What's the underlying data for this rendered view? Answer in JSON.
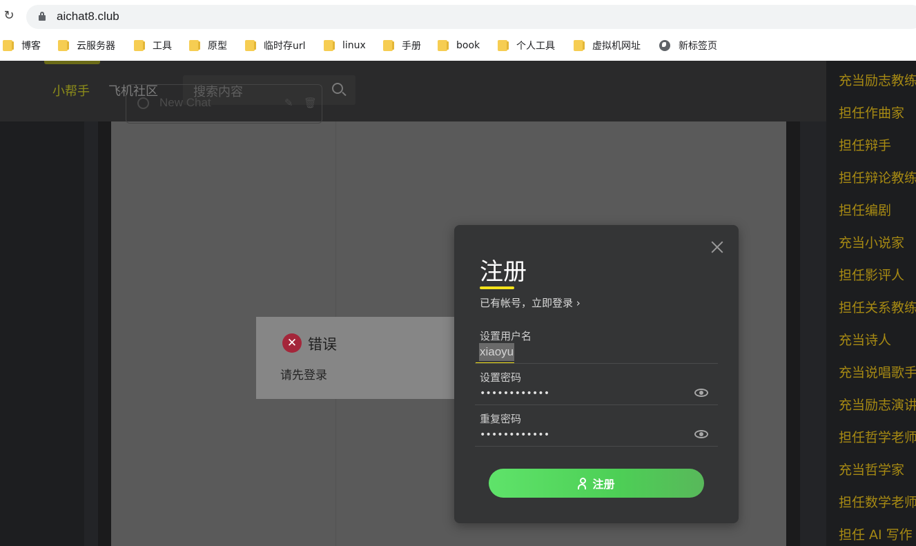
{
  "browser": {
    "url": "aichat8.club",
    "bookmarks": [
      {
        "label": "博客",
        "icon": "folder-icon"
      },
      {
        "label": "云服务器",
        "icon": "folder-icon"
      },
      {
        "label": "工具",
        "icon": "folder-icon"
      },
      {
        "label": "原型",
        "icon": "folder-icon"
      },
      {
        "label": "临时存url",
        "icon": "folder-icon"
      },
      {
        "label": "linux",
        "icon": "folder-icon"
      },
      {
        "label": "手册",
        "icon": "folder-icon"
      },
      {
        "label": "book",
        "icon": "folder-icon"
      },
      {
        "label": "个人工具",
        "icon": "folder-icon"
      },
      {
        "label": "虚拟机网址",
        "icon": "folder-icon"
      },
      {
        "label": "新标签页",
        "icon": "globe-icon"
      }
    ]
  },
  "header": {
    "nav": [
      "小帮手",
      "飞机社区"
    ],
    "search_placeholder": "搜索内容"
  },
  "sidebar": {
    "new_chat_label": "New Chat"
  },
  "roles": [
    "充当励志教练",
    "担任作曲家",
    "担任辩手",
    "担任辩论教练",
    "担任编剧",
    "充当小说家",
    "担任影评人",
    "担任关系教练",
    "充当诗人",
    "充当说唱歌手",
    "充当励志演讲",
    "担任哲学老师",
    "充当哲学家",
    "担任数学老师",
    "担任 AI 写作"
  ],
  "toast": {
    "title": "错误",
    "message": "请先登录"
  },
  "modal": {
    "title": "注册",
    "login_link": "已有帐号，立即登录",
    "username_label": "设置用户名",
    "username_value": "xiaoyu",
    "password_label": "设置密码",
    "password_value": "••••••••••••",
    "confirm_label": "重复密码",
    "confirm_value": "••••••••••••",
    "submit_label": "注册"
  },
  "colors": {
    "accent_yellow": "#f3e21a",
    "role_text": "#a78a13",
    "button_green": "#5fe36a",
    "error_red": "#a4263a"
  }
}
